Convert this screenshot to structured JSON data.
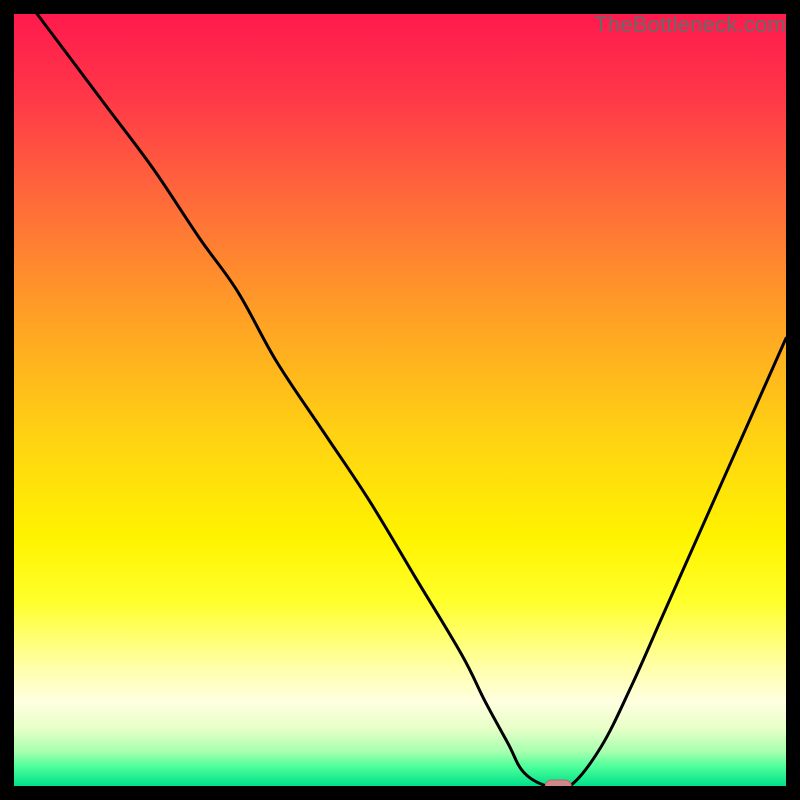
{
  "watermark": "TheBottleneck.com",
  "colors": {
    "background": "#000000",
    "curve": "#000000",
    "marker_fill": "#d08888",
    "marker_stroke": "#b86868",
    "gradient_stops": [
      {
        "offset": 0.0,
        "color": "#ff1a4d"
      },
      {
        "offset": 0.1,
        "color": "#ff3549"
      },
      {
        "offset": 0.24,
        "color": "#ff6a3a"
      },
      {
        "offset": 0.4,
        "color": "#ffa324"
      },
      {
        "offset": 0.55,
        "color": "#ffd312"
      },
      {
        "offset": 0.68,
        "color": "#fff400"
      },
      {
        "offset": 0.76,
        "color": "#ffff2a"
      },
      {
        "offset": 0.84,
        "color": "#ffffa0"
      },
      {
        "offset": 0.89,
        "color": "#ffffe0"
      },
      {
        "offset": 0.925,
        "color": "#e8ffc8"
      },
      {
        "offset": 0.955,
        "color": "#a8ffb0"
      },
      {
        "offset": 0.975,
        "color": "#4dff9a"
      },
      {
        "offset": 1.0,
        "color": "#00e08a"
      }
    ]
  },
  "chart_data": {
    "type": "line",
    "title": "",
    "xlabel": "",
    "ylabel": "",
    "xlim": [
      0,
      100
    ],
    "ylim": [
      0,
      100
    ],
    "x": [
      0,
      6,
      12,
      18,
      24,
      29,
      34,
      40,
      46,
      52,
      58,
      61,
      64,
      66,
      69,
      72,
      76,
      80,
      84,
      88,
      92,
      96,
      100
    ],
    "values": [
      104,
      96,
      88,
      80,
      71,
      64,
      55,
      46,
      37,
      27,
      17,
      11,
      5.5,
      1.8,
      0,
      0,
      5,
      13,
      22,
      31,
      40,
      49,
      58
    ],
    "marker": {
      "x": 70.5,
      "y": 0
    }
  }
}
